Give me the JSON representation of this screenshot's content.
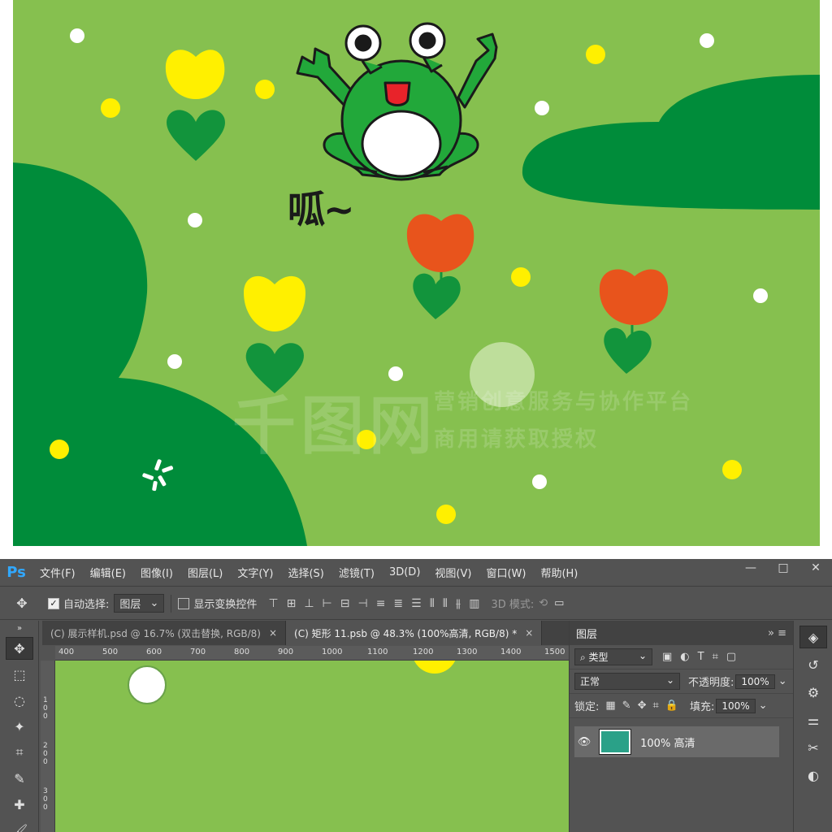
{
  "artwork": {
    "croak_text": "呱~",
    "watermark_logo": "千图网",
    "watermark_line1": "营销创意服务与协作平台",
    "watermark_line2": "商用请获取授权"
  },
  "colors": {
    "background_green": "#86c04f",
    "hill_green": "#008c3a",
    "frog_green": "#22a83a",
    "tulip_yellow": "#fff000",
    "tulip_orange": "#e8541c",
    "leaf_green": "#12943c"
  },
  "app": {
    "logo": "Ps",
    "menu": [
      "文件(F)",
      "编辑(E)",
      "图像(I)",
      "图层(L)",
      "文字(Y)",
      "选择(S)",
      "滤镜(T)",
      "3D(D)",
      "视图(V)",
      "窗口(W)",
      "帮助(H)"
    ],
    "window_buttons": [
      "—",
      "□",
      "✕"
    ]
  },
  "options": {
    "auto_select_label": "自动选择:",
    "auto_select_value": "图层",
    "show_transform_label": "显示变换控件",
    "mode_3d_label": "3D 模式:"
  },
  "tabs": [
    {
      "label": "(C) 展示样机.psd @ 16.7% (双击替换, RGB/8)",
      "close": "×"
    },
    {
      "label": "(C) 矩形 11.psb @ 48.3% (100%高清, RGB/8) *",
      "close": "×"
    }
  ],
  "ruler": {
    "h": [
      "400",
      "500",
      "600",
      "700",
      "800",
      "900",
      "1000",
      "1100",
      "1200",
      "1300",
      "1400",
      "1500"
    ],
    "v": [
      "100",
      "200",
      "300"
    ]
  },
  "layers_panel": {
    "title": "图层",
    "filter_label": "类型",
    "blend_mode": "正常",
    "opacity_label": "不透明度:",
    "opacity_value": "100%",
    "lock_label": "锁定:",
    "fill_label": "填充:",
    "fill_value": "100%",
    "layer_name": "100% 高清"
  },
  "icons": [
    "move-icon",
    "marquee-icon",
    "lasso-icon",
    "magic-wand-icon",
    "crop-icon",
    "eyedropper-icon",
    "healing-icon",
    "brush-icon",
    "eye-icon",
    "layers-icon",
    "history-icon",
    "properties-icon",
    "tools-icon"
  ]
}
